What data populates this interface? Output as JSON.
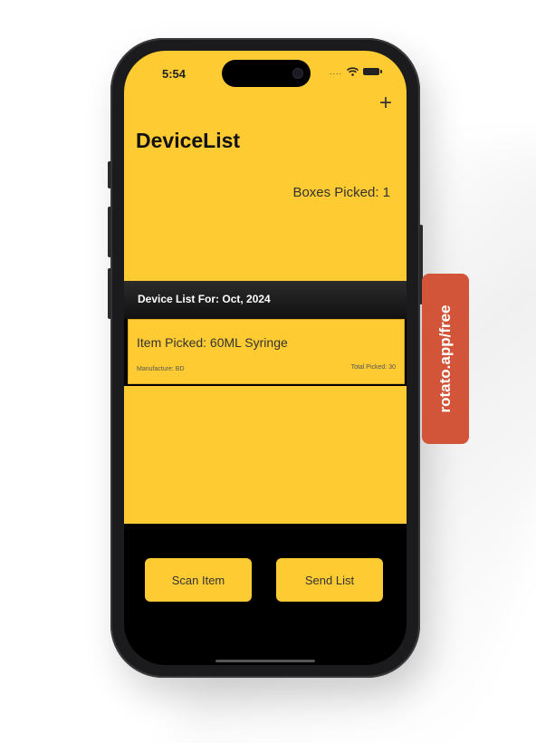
{
  "status_bar": {
    "time": "5:54",
    "signal": "....",
    "wifi_icon": "wifi-icon",
    "battery_icon": "battery-icon"
  },
  "header": {
    "add_label": "+",
    "title": "DeviceList",
    "boxes_picked": "Boxes Picked: 1"
  },
  "list": {
    "section_title": "Device List For: Oct, 2024",
    "items": [
      {
        "item": "Item Picked: 60ML Syringe",
        "manufacture": "Manufacture: BD",
        "total": "Total Picked: 30"
      }
    ]
  },
  "actions": {
    "scan_label": "Scan Item",
    "send_label": "Send List"
  },
  "badge": {
    "text": "rotato.app/free"
  },
  "colors": {
    "accent": "#fecb33",
    "phone": "#1b1b1d",
    "badge": "#d2553a"
  }
}
